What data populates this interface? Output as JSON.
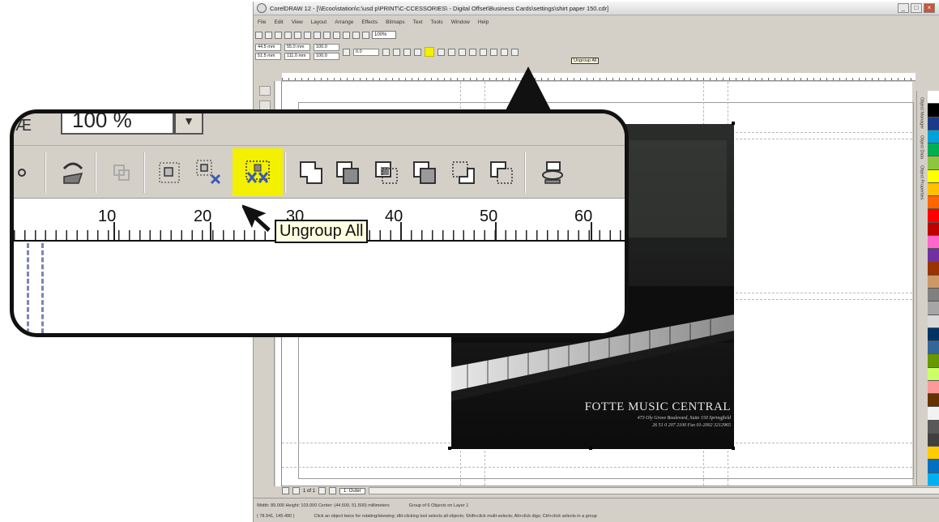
{
  "window": {
    "title": "CorelDRAW 12 - [\\\\Ecoo\\station\\c:\\usd p\\PRINT\\C-CCESSORIES\\ - Digital Offset\\Business Cards\\settings\\shirt paper 150.cdr]",
    "buttons": [
      "_",
      "□",
      "×"
    ]
  },
  "menu": [
    "File",
    "Edit",
    "View",
    "Layout",
    "Arrange",
    "Effects",
    "Bitmaps",
    "Text",
    "Tools",
    "Window",
    "Help"
  ],
  "standard_bar": {
    "zoom": "100%"
  },
  "property_bar": {
    "x": "44.5 mm",
    "y": "51.5 mm",
    "width": "55.0 mm",
    "height": "111.0 mm",
    "scale_w": "100.0",
    "scale_h": "100.0",
    "angle": "0.0",
    "tooltip": "Ungroup All"
  },
  "ruler": {
    "unit": "millimeters"
  },
  "poster": {
    "title": "FOTTE MUSIC CENTRAL",
    "line1": "473 Oly Grove Boulevard, Suite 150 Springfield",
    "line2": "26 51 0 207 2100 Fax 01-2002 3212965"
  },
  "docker_tabs": [
    "Object Manager",
    "Object Data",
    "Object Properties"
  ],
  "page_nav": {
    "page_count": "1 of 1",
    "page_tab": "1: Outer"
  },
  "status": {
    "dimensions": "Width: 89.000 Height: 103.000 Center: (44.500, 51.500) millimeters",
    "selection": "Group of 6 Objects on Layer 1",
    "coords": "( 78.941, 145.490 )",
    "hint": "Click an object twice for rotating/skewing; dbl-clicking tool selects all objects; Shift+click multi-selects; Alt+click digs; Ctrl+click selects in a group"
  },
  "callout": {
    "zoom_value": "100 %",
    "tooltip": "Ungroup All",
    "ruler_numbers": [
      "10",
      "20",
      "30",
      "40",
      "50",
      "60"
    ]
  },
  "colors": {
    "highlight": "#f3f000",
    "ui_gray": "#d4d0c8",
    "tooltip_bg": "#ffffe1"
  },
  "palette": [
    "#ffffff",
    "#000000",
    "#1a3a8a",
    "#00a3d9",
    "#00b050",
    "#8cc63f",
    "#ffff00",
    "#ffc000",
    "#ff6600",
    "#ff0000",
    "#c00000",
    "#ff66cc",
    "#7030a0",
    "#993300",
    "#cc9966",
    "#808080",
    "#a6a6a6",
    "#d9d9d9",
    "#003366",
    "#336699",
    "#669900",
    "#ccff66",
    "#ff9999",
    "#663300",
    "#f2f2f2",
    "#595959",
    "#404040",
    "#ffcc00",
    "#0070c0",
    "#00b0f0"
  ]
}
